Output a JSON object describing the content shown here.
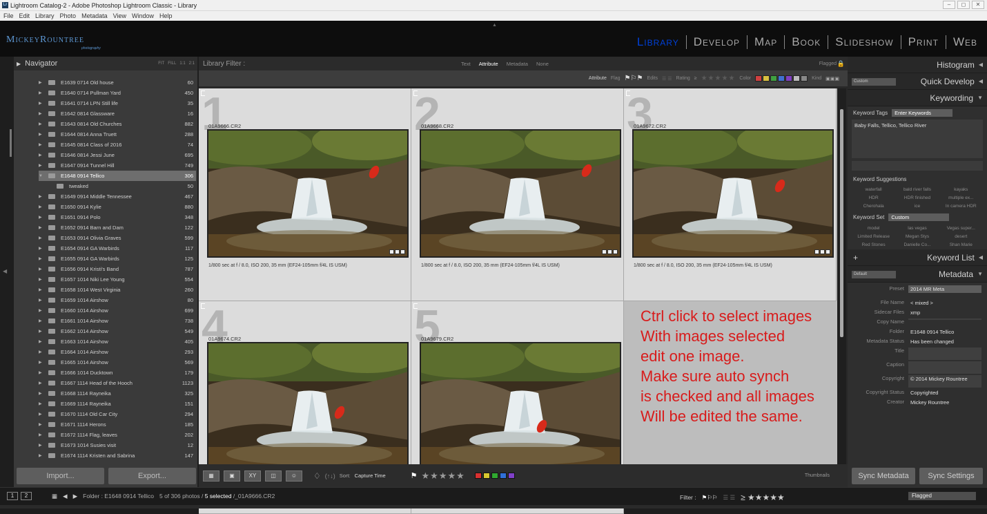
{
  "window": {
    "title": "Lightroom Catalog-2 - Adobe Photoshop Lightroom Classic - Library",
    "app_icon": "Lr"
  },
  "menu": [
    "File",
    "Edit",
    "Library",
    "Photo",
    "Metadata",
    "View",
    "Window",
    "Help"
  ],
  "identity_plate": {
    "name": "MickeyRountree",
    "sub": "photography"
  },
  "modules": [
    "Library",
    "Develop",
    "Map",
    "Book",
    "Slideshow",
    "Print",
    "Web"
  ],
  "left": {
    "navigator": {
      "label": "Navigator",
      "zoom": [
        "FIT",
        "FILL",
        "1:1",
        "2:1"
      ]
    },
    "folders": [
      {
        "name": "E1639 0714 Old house",
        "count": "60"
      },
      {
        "name": "E1640 0714 Pullman Yard",
        "count": "450"
      },
      {
        "name": "E1641 0714 LPN Still life",
        "count": "35"
      },
      {
        "name": "E1642  0814 Glassware",
        "count": "16"
      },
      {
        "name": "E1643 0814 Old Churches",
        "count": "882"
      },
      {
        "name": "E1644 0814 Anna Truett",
        "count": "288"
      },
      {
        "name": "E1645 0814 Class of 2016",
        "count": "74"
      },
      {
        "name": "E1646 0814 Jessi June",
        "count": "695"
      },
      {
        "name": "E1647 0914 Tunnel Hill",
        "count": "749"
      },
      {
        "name": "E1648 0914 Tellico",
        "count": "306"
      },
      {
        "name": "tweaked",
        "count": "50"
      },
      {
        "name": "E1649 0914 Middle Tennessee",
        "count": "467"
      },
      {
        "name": "E1650 0914 Kylie",
        "count": "880"
      },
      {
        "name": "E1651 0914 Polo",
        "count": "348"
      },
      {
        "name": "E1652 0914 Barn and Dam",
        "count": "122"
      },
      {
        "name": "E1653 0914 Olivia Graves",
        "count": "599"
      },
      {
        "name": "E1654 0914 GA Warbirds",
        "count": "117"
      },
      {
        "name": "E1655 0914 GA Warbirds",
        "count": "125"
      },
      {
        "name": "E1656 0914 Kristi's Band",
        "count": "787"
      },
      {
        "name": "E1657 1014 Niki Lee Young",
        "count": "554"
      },
      {
        "name": "E1658 1014 West Virginia",
        "count": "260"
      },
      {
        "name": "E1659 1014 Airshow",
        "count": "80"
      },
      {
        "name": "E1660 1014 Airshow",
        "count": "699"
      },
      {
        "name": "E1661 1014 Airshow",
        "count": "738"
      },
      {
        "name": "E1662 1014 Airshow",
        "count": "549"
      },
      {
        "name": "E1663 1014 Airshow",
        "count": "405"
      },
      {
        "name": "E1664 1014 Airshow",
        "count": "293"
      },
      {
        "name": "E1665 1014 Airshow",
        "count": "569"
      },
      {
        "name": "E1666 1014 Ducktown",
        "count": "179"
      },
      {
        "name": "E1667 1114 Head of the Hooch",
        "count": "1123"
      },
      {
        "name": "E1668 1114 Rayneika",
        "count": "325"
      },
      {
        "name": "E1669 1114 Rayneika",
        "count": "151"
      },
      {
        "name": "E1670 1114 Old Car City",
        "count": "294"
      },
      {
        "name": "E1671 1114 Herons",
        "count": "185"
      },
      {
        "name": "E1672 1114 Flag, leaves",
        "count": "202"
      },
      {
        "name": "E1673 1014 Susies visit",
        "count": "12"
      },
      {
        "name": "E1674 1114 Kristen and Sabrina",
        "count": "147"
      }
    ],
    "import_label": "Import...",
    "export_label": "Export..."
  },
  "filter": {
    "label": "Library Filter :",
    "tabs": [
      "Text",
      "Attribute",
      "Metadata",
      "None"
    ],
    "flagged": "Flagged",
    "attribute_label": "Attribute",
    "flag_label": "Flag",
    "edits_label": "Edits",
    "rating_label": "Rating",
    "rating_op": "≥",
    "color_label": "Color",
    "kind_label": "Kind",
    "colors": [
      "#d04040",
      "#d8c040",
      "#40a040",
      "#4070d0",
      "#8040c0",
      "#bbbbbb",
      "#888888"
    ]
  },
  "photos": [
    {
      "index": "1",
      "file": "01A9666.CR2",
      "meta": "1/800 sec at f / 8.0, ISO 200, 35 mm (EF24-105mm f/4L IS USM)"
    },
    {
      "index": "2",
      "file": "01A9668.CR2",
      "meta": "1/800 sec at f / 8.0, ISO 200, 35 mm (EF24-105mm f/4L IS USM)"
    },
    {
      "index": "3",
      "file": "01A9672.CR2",
      "meta": "1/800 sec at f / 8.0, ISO 200, 35 mm (EF24-105mm f/4L IS USM)"
    },
    {
      "index": "4",
      "file": "01A9674.CR2",
      "meta": ""
    },
    {
      "index": "5",
      "file": "01A9679.CR2",
      "meta": ""
    }
  ],
  "instructions": [
    "Ctrl click to select images",
    "With images selected",
    "edit one image.",
    "Make sure auto synch",
    "is checked and all images",
    "Will be edited the same."
  ],
  "toolbar": {
    "sort_label": "Sort:",
    "sort_value": "Capture Time",
    "stars": "★★★★★",
    "thumbnails_label": "Thumbnails",
    "colors": [
      "#d83030",
      "#d8c830",
      "#30a830",
      "#3070d8",
      "#8040c8"
    ]
  },
  "right": {
    "histogram": "Histogram",
    "quick_preset": "Custom",
    "quick_develop": "Quick Develop",
    "keywording": "Keywording",
    "keyword_tags_label": "Keyword Tags",
    "keyword_tags_value": "Enter Keywords",
    "keywords": "Baby Falls, Tellico, Tellico River",
    "keyword_suggestions": "Keyword Suggestions",
    "suggestions": [
      "waterfall",
      "bald river falls",
      "kayaks",
      "HDR",
      "HDR finished",
      "multiple ex...",
      "Cherohala",
      "ice",
      "In camera HDR"
    ],
    "keyword_set_label": "Keyword Set",
    "keyword_set_value": "Custom",
    "keyword_set": [
      "model",
      "las vegas",
      "Vegas super...",
      "Limited Release",
      "Megan Stys",
      "desert",
      "Red Stones",
      "Danielle Co...",
      "Shan Marie"
    ],
    "keyword_list": "Keyword List",
    "metadata": "Metadata",
    "metadata_preset_dropdown": "Default",
    "preset_label": "Preset",
    "preset_value": "2014 MR Meta",
    "fields": [
      {
        "k": "File Name",
        "v": "< mixed >"
      },
      {
        "k": "Sidecar Files",
        "v": "xmp"
      },
      {
        "k": "Copy Name",
        "v": ""
      },
      {
        "k": "Folder",
        "v": "E1648 0914 Tellico"
      },
      {
        "k": "Metadata Status",
        "v": "Has been changed"
      },
      {
        "k": "Title",
        "v": ""
      },
      {
        "k": "Caption",
        "v": ""
      },
      {
        "k": "Copyright",
        "v": "© 2014 Mickey Rountree"
      },
      {
        "k": "Copyright Status",
        "v": "Copyrighted"
      },
      {
        "k": "Creator",
        "v": "Mickey Rountree"
      }
    ],
    "sync_metadata": "Sync Metadata",
    "sync_settings": "Sync Settings"
  },
  "filmstrip": {
    "pages": [
      "1",
      "2"
    ],
    "folder": "Folder : E1648 0914 Tellico",
    "status_pre": "5 of 306 photos /",
    "status_sel": "5 selected",
    "status_post": "/_01A9666.CR2",
    "filter_label": "Filter :",
    "filter_value": "Flagged"
  }
}
